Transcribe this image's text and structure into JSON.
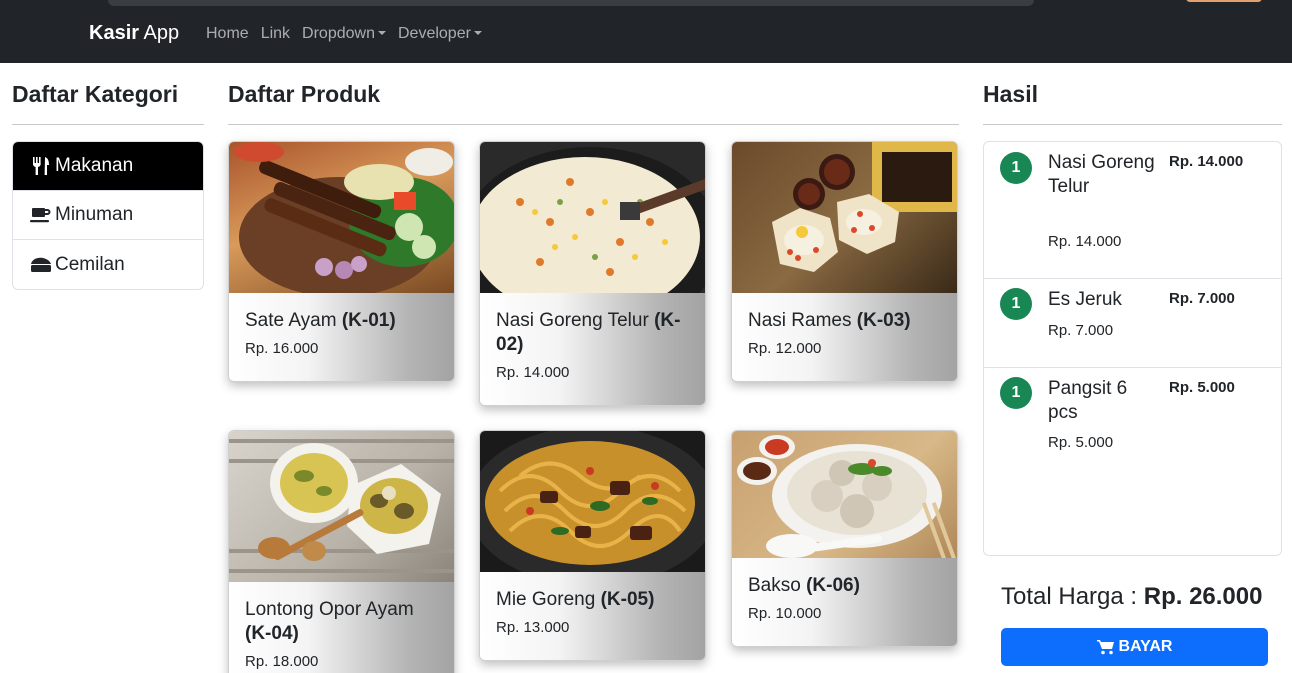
{
  "navbar": {
    "brand_bold": "Kasir",
    "brand_rest": " App",
    "links": [
      "Home",
      "Link",
      "Dropdown",
      "Developer"
    ]
  },
  "kategori": {
    "heading": "Daftar Kategori",
    "items": [
      {
        "label": "Makanan",
        "icon": "utensils-icon",
        "active": true
      },
      {
        "label": "Minuman",
        "icon": "coffee-icon",
        "active": false
      },
      {
        "label": "Cemilan",
        "icon": "cheese-icon",
        "active": false
      }
    ]
  },
  "produk": {
    "heading": "Daftar Produk",
    "items": [
      {
        "name": "Sate Ayam",
        "code": "(K-01)",
        "price": "Rp. 16.000"
      },
      {
        "name": "Nasi Goreng Telur",
        "code": "(K-02)",
        "price": "Rp. 14.000"
      },
      {
        "name": "Nasi Rames",
        "code": "(K-03)",
        "price": "Rp. 12.000"
      },
      {
        "name": "Lontong Opor Ayam",
        "code": "(K-04)",
        "price": "Rp. 18.000"
      },
      {
        "name": "Mie Goreng",
        "code": "(K-05)",
        "price": "Rp. 13.000"
      },
      {
        "name": "Bakso",
        "code": "(K-06)",
        "price": "Rp. 10.000"
      }
    ]
  },
  "hasil": {
    "heading": "Hasil",
    "items": [
      {
        "qty": "1",
        "name": "Nasi Goreng Telur",
        "sub": "Rp. 14.000",
        "total": "Rp. 14.000"
      },
      {
        "qty": "1",
        "name": "Es Jeruk",
        "sub": "Rp. 7.000",
        "total": "Rp. 7.000"
      },
      {
        "qty": "1",
        "name": "Pangsit 6 pcs",
        "sub": "Rp. 5.000",
        "total": "Rp. 5.000"
      }
    ],
    "total_label": "Total Harga : ",
    "total_value": "Rp. 26.000",
    "pay_label": "BAYAR"
  },
  "colors": {
    "navbar": "#212529",
    "active_category": "#000000",
    "badge": "#198754",
    "pay_button": "#0d6efd"
  }
}
